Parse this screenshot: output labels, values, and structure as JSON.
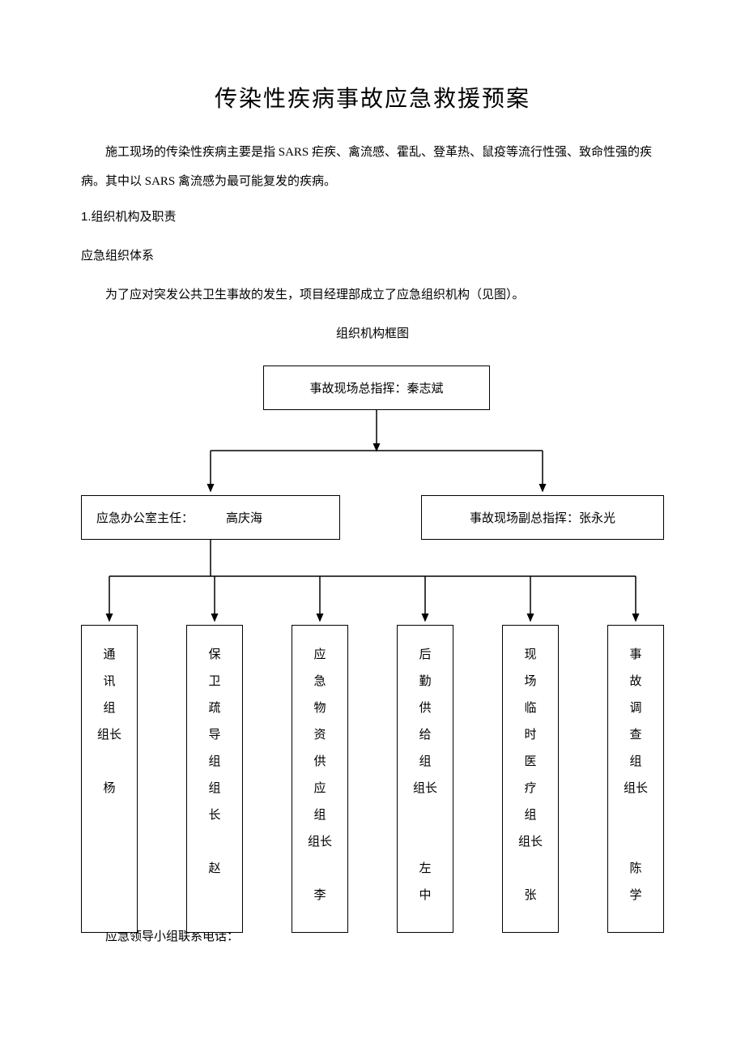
{
  "title": "传染性疾病事故应急救援预案",
  "para1": "施工现场的传染性疾病主要是指 SARS 疟疾、禽流感、霍乱、登革热、鼠疫等流行性强、致命性强的疾病。其中以 SARS 禽流感为最可能复发的疾病。",
  "section1": "1.组织机构及职责",
  "sub1": "应急组织体系",
  "para2": "为了应对突发公共卫生事故的发生，项目经理部成立了应急组织机构（见图）。",
  "chart_caption": "组织机构框图",
  "chart_data": {
    "type": "org-chart",
    "top": {
      "label": "事故现场总指挥：秦志斌"
    },
    "middle": [
      {
        "label_prefix": "应急办公室主任：",
        "label_name": "高庆海"
      },
      {
        "label": "事故现场副总指挥：张永光"
      }
    ],
    "bottom": [
      {
        "lines": [
          "通",
          "讯",
          "组",
          "组长",
          "",
          "杨"
        ]
      },
      {
        "lines": [
          "保",
          "卫",
          "疏",
          "导",
          "组",
          "组",
          "长",
          "",
          "赵"
        ]
      },
      {
        "lines": [
          "应",
          "急",
          "物",
          "资",
          "供",
          "应",
          "组",
          "组长",
          "",
          "李"
        ]
      },
      {
        "lines": [
          "后",
          "勤",
          "供",
          "给",
          "组",
          "组长",
          "",
          "",
          "左",
          "中"
        ]
      },
      {
        "lines": [
          "现",
          "场",
          "临",
          "时",
          "医",
          "疗",
          "组",
          "组长",
          "",
          "张"
        ]
      },
      {
        "lines": [
          "事",
          "故",
          "调",
          "查",
          "组",
          "组长",
          "",
          "",
          "陈",
          "学"
        ]
      }
    ]
  },
  "footer": "应急领导小组联系电话："
}
